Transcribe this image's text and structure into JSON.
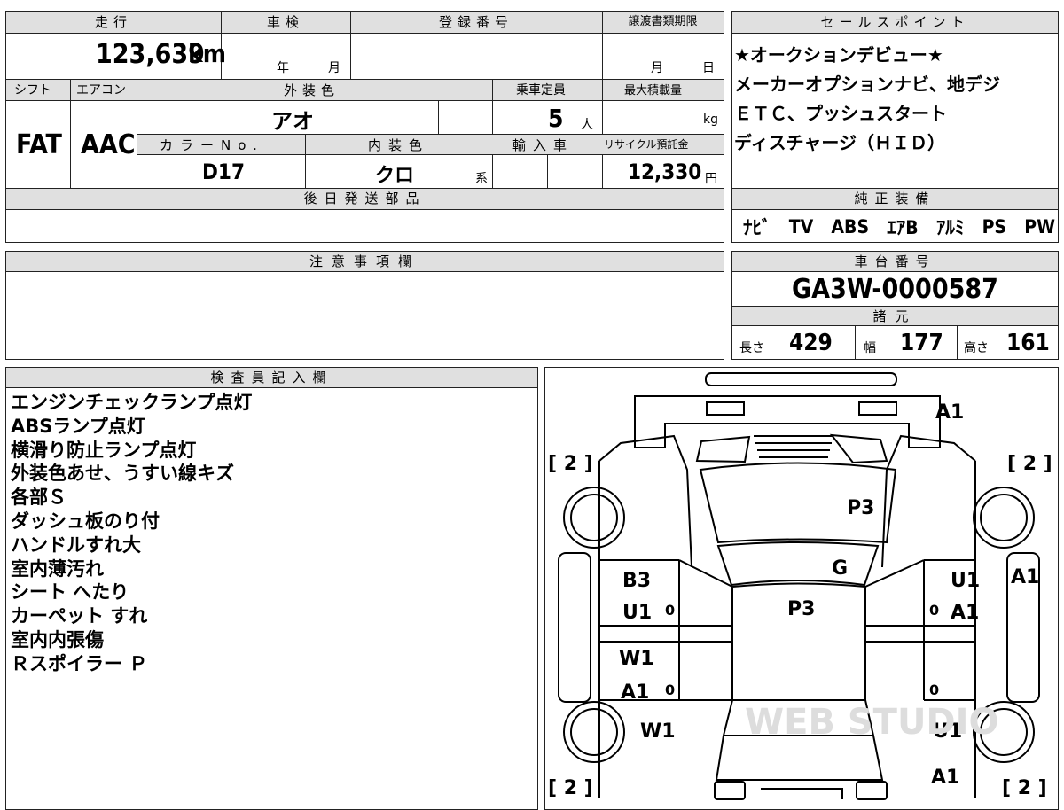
{
  "top_form": {
    "mileage": {
      "label": "走行",
      "value": "123,639",
      "unit": "km"
    },
    "inspection": {
      "label": "車検",
      "year_unit": "年",
      "month_unit": "月"
    },
    "registration": {
      "label": "登録番号"
    },
    "transfer_deadline": {
      "label": "譲渡書類期限",
      "month_unit": "月",
      "day_unit": "日"
    },
    "shift": {
      "label": "シフト",
      "value": "FAT"
    },
    "aircon": {
      "label": "エアコン",
      "value": "AAC"
    },
    "exterior_color": {
      "label": "外装色",
      "value": "アオ"
    },
    "capacity": {
      "label": "乗車定員",
      "value": "5",
      "unit": "人"
    },
    "max_load": {
      "label": "最大積載量",
      "unit": "kg"
    },
    "color_no": {
      "label": "カラーNo.",
      "value": "D17"
    },
    "interior_color": {
      "label": "内装色",
      "value": "クロ",
      "suffix": "系"
    },
    "import": {
      "label": "輸入車"
    },
    "recycle": {
      "label": "リサイクル預託金",
      "value": "12,330",
      "unit": "円"
    },
    "later_parts": {
      "label": "後日発送部品"
    }
  },
  "sales_points": {
    "label": "セールスポイント",
    "lines": [
      "★オークションデビュー★",
      "メーカーオプションナビ、地デジ",
      "ＥＴＣ、プッシュスタート",
      "ディスチャージ（ＨＩＤ）"
    ]
  },
  "equipment": {
    "label": "純正装備",
    "items": [
      "ﾅﾋﾞ",
      "TV",
      "ABS",
      "ｴｱB",
      "ｱﾙﾐ",
      "PS",
      "PW"
    ]
  },
  "notes": {
    "label": "注意事項欄"
  },
  "chassis": {
    "label": "車台番号",
    "value": "GA3W-0000587"
  },
  "specs": {
    "label": "諸元",
    "length_label": "長さ",
    "length": "429",
    "width_label": "幅",
    "width": "177",
    "height_label": "高さ",
    "height": "161"
  },
  "inspector": {
    "label": "検査員記入欄",
    "lines": [
      "エンジンチェックランプ点灯",
      "ABSランプ点灯",
      "横滑り防止ランプ点灯",
      "外装色あせ、うすい線キズ",
      "各部Ｓ",
      "ダッシュ板のり付",
      "ハンドルすれ大",
      "室内薄汚れ",
      "シート へたり",
      "カーペット すれ",
      "室内内張傷",
      "Ｒスポイラー Ｐ"
    ]
  },
  "diagram": {
    "codes": {
      "front_bumper": "A1",
      "hood": "P3",
      "windshield": "G",
      "roof": "P3",
      "left_front_door": [
        "B3",
        "U1"
      ],
      "left_rear_door": [
        "W1",
        "A1"
      ],
      "left_rear_fender": "W1",
      "right_front_door": [
        "U1",
        "A1"
      ],
      "right_front_fender": "A1",
      "right_rear_fender": "U1",
      "rear_right": "A1"
    },
    "tire_marks": [
      "[ 2 ]",
      "[ 2 ]",
      "[ 2 ]",
      "[ 2 ]"
    ],
    "zero": "0",
    "watermark": "WEB STUDIO"
  }
}
